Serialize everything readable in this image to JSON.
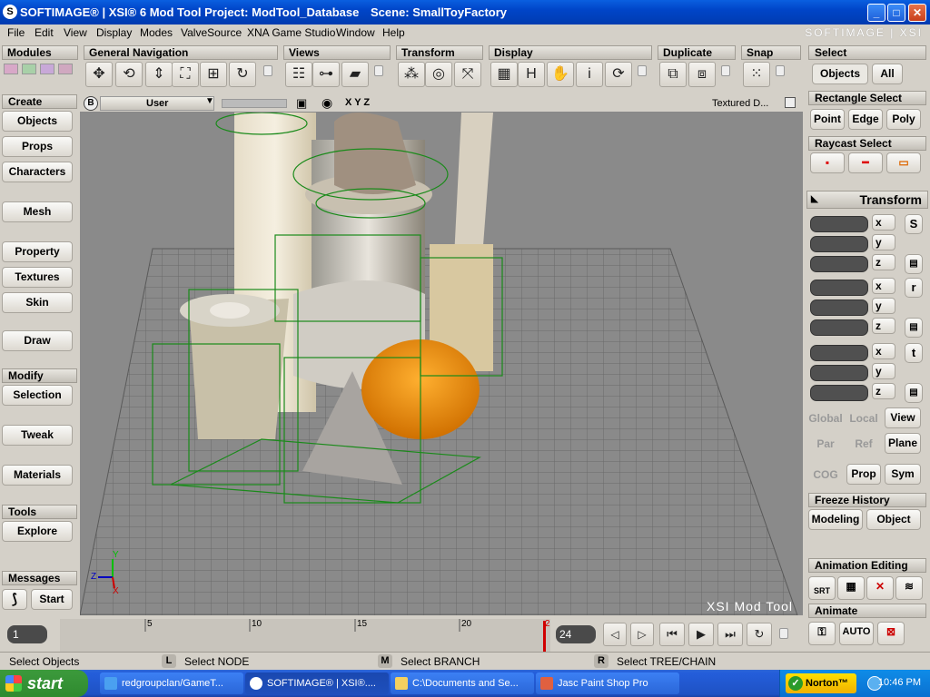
{
  "window": {
    "title": "SOFTIMAGE® | XSI® 6 Mod Tool Project: ModTool_Database",
    "scene": "Scene: SmallToyFactory",
    "app_icon": "S",
    "min": "_",
    "max": "□",
    "close": "✕"
  },
  "menu": {
    "items": [
      "File",
      "Edit",
      "View",
      "Display",
      "Modes",
      "ValveSource",
      "XNA Game Studio",
      "Window",
      "Help"
    ],
    "brand": "SOFTIMAGE | XSI"
  },
  "toolbar": {
    "modules": "Modules",
    "general_navigation": "General Navigation",
    "views": "Views",
    "transform": "Transform",
    "display": "Display",
    "duplicate": "Duplicate",
    "snap": "Snap",
    "display_h": "H",
    "display_i": "i"
  },
  "left": {
    "create": "Create",
    "objects": "Objects",
    "props": "Props",
    "characters": "Characters",
    "mesh": "Mesh",
    "property": "Property",
    "textures": "Textures",
    "skin": "Skin",
    "draw": "Draw",
    "modify": "Modify",
    "selection": "Selection",
    "tweak": "Tweak",
    "materials": "Materials",
    "tools": "Tools",
    "explore": "Explore",
    "messages": "Messages",
    "start": "Start"
  },
  "viewport": {
    "letter": "B",
    "camera": "User",
    "xyz": "X Y Z",
    "display_mode": "Textured D...",
    "watermark": "XSI Mod Tool"
  },
  "right": {
    "select": "Select",
    "objects": "Objects",
    "all": "All",
    "rectangle_select": "Rectangle Select",
    "point": "Point",
    "edge": "Edge",
    "poly": "Poly",
    "raycast_select": "Raycast Select",
    "transform": "Transform",
    "x": "x",
    "y": "y",
    "z": "z",
    "s": "S",
    "r": "r",
    "t": "t",
    "global": "Global",
    "local": "Local",
    "view": "View",
    "par": "Par",
    "ref": "Ref",
    "plane": "Plane",
    "cog": "COG",
    "prop": "Prop",
    "sym": "Sym",
    "freeze_history": "Freeze History",
    "modeling": "Modeling",
    "object": "Object",
    "animation_editing": "Animation Editing",
    "srt": "SRT",
    "animate": "Animate",
    "auto": "AUTO"
  },
  "timeline": {
    "start_frame": "1",
    "ticks": [
      "5",
      "10",
      "15",
      "20"
    ],
    "current_frame": "2",
    "end_frame": "24"
  },
  "status": {
    "left": "Select Objects",
    "l_key": "L",
    "l_text": "Select NODE",
    "m_key": "M",
    "m_text": "Select BRANCH",
    "r_key": "R",
    "r_text": "Select TREE/CHAIN"
  },
  "taskbar": {
    "start": "start",
    "tasks": [
      "redgroupclan/GameT...",
      "SOFTIMAGE® | XSI®....",
      "C:\\Documents and Se...",
      "Jasc Paint Shop Pro"
    ],
    "norton": "Norton™",
    "clock": "10:46 PM"
  },
  "colors": {
    "xp_blue": "#0045c8",
    "start_green": "#2f8a2f",
    "wireframe_green": "#1a8a1a",
    "timeline_marker": "#d00000"
  }
}
